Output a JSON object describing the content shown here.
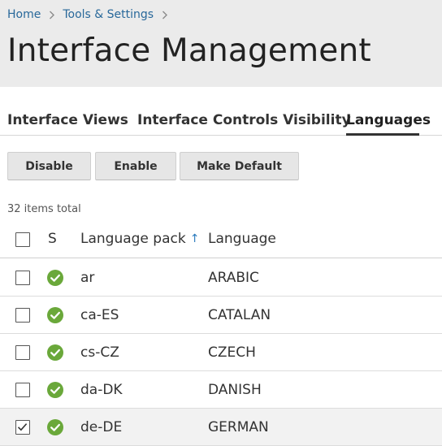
{
  "breadcrumb": {
    "items": [
      {
        "label": "Home"
      },
      {
        "label": "Tools & Settings"
      }
    ]
  },
  "page": {
    "title": "Interface Management"
  },
  "tabs": [
    {
      "label": "Interface Views",
      "active": false
    },
    {
      "label": "Interface Controls Visibility",
      "active": false
    },
    {
      "label": "Languages",
      "active": true
    }
  ],
  "toolbar": {
    "disable_label": "Disable",
    "enable_label": "Enable",
    "make_default_label": "Make Default"
  },
  "list": {
    "total_text": "32 items total"
  },
  "table": {
    "columns": {
      "status": "S",
      "pack": "Language pack",
      "pack_sort": "↑",
      "language": "Language"
    },
    "rows": [
      {
        "pack": "ar",
        "language": "ARABIC",
        "checked": false,
        "status": "enabled"
      },
      {
        "pack": "ca-ES",
        "language": "CATALAN",
        "checked": false,
        "status": "enabled"
      },
      {
        "pack": "cs-CZ",
        "language": "CZECH",
        "checked": false,
        "status": "enabled"
      },
      {
        "pack": "da-DK",
        "language": "DANISH",
        "checked": false,
        "status": "enabled"
      },
      {
        "pack": "de-DE",
        "language": "GERMAN",
        "checked": true,
        "status": "enabled"
      }
    ]
  },
  "colors": {
    "link": "#28689a",
    "status_ok": "#6aa83a",
    "sort_arrow": "#2b7bbd",
    "header_bg": "#ebebeb"
  }
}
